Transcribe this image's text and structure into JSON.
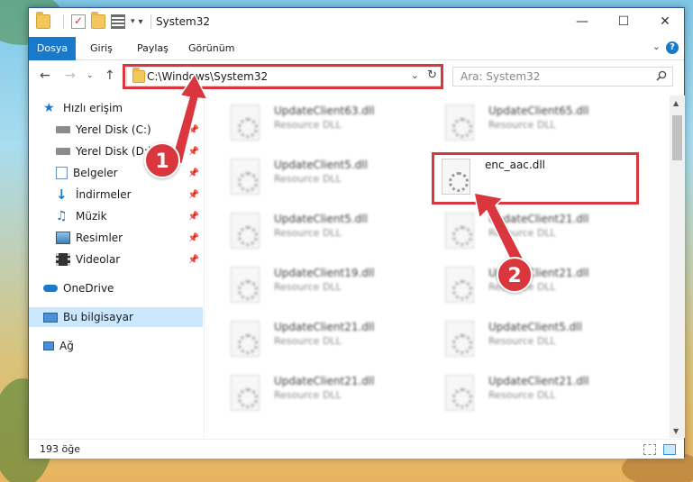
{
  "window": {
    "title": "System32"
  },
  "ribbon": {
    "tabs": [
      "Dosya",
      "Giriş",
      "Paylaş",
      "Görünüm"
    ]
  },
  "address": {
    "path": "C:\\Windows\\System32"
  },
  "search": {
    "placeholder": "Ara: System32"
  },
  "sidebar": {
    "items": [
      {
        "label": "Hızlı erişim",
        "icon": "star-icon"
      },
      {
        "label": "Yerel Disk (C:)",
        "icon": "drive-icon",
        "pinned": true
      },
      {
        "label": "Yerel Disk (D:)",
        "icon": "drive-icon",
        "pinned": true
      },
      {
        "label": "Belgeler",
        "icon": "documents-icon",
        "pinned": true
      },
      {
        "label": "İndirmeler",
        "icon": "download-icon",
        "pinned": true
      },
      {
        "label": "Müzik",
        "icon": "music-icon",
        "pinned": true
      },
      {
        "label": "Resimler",
        "icon": "pictures-icon",
        "pinned": true
      },
      {
        "label": "Videolar",
        "icon": "videos-icon",
        "pinned": true
      },
      {
        "label": "OneDrive",
        "icon": "cloud-icon"
      },
      {
        "label": "Bu bilgisayar",
        "icon": "computer-icon",
        "selected": true
      },
      {
        "label": "Ağ",
        "icon": "network-icon"
      }
    ]
  },
  "files": [
    {
      "name": "UpdateClient63.dll",
      "type": "Resource DLL"
    },
    {
      "name": "UpdateClient65.dll",
      "type": "Resource DLL"
    },
    {
      "name": "UpdateClient5.dll",
      "type": "Resource DLL"
    },
    {
      "name": "enc_aac.dll",
      "type": ""
    },
    {
      "name": "UpdateClient5.dll",
      "type": "Resource DLL"
    },
    {
      "name": "UpdateClient21.dll",
      "type": "Resource DLL"
    },
    {
      "name": "UpdateClient19.dll",
      "type": "Resource DLL"
    },
    {
      "name": "UpdateClient21.dll",
      "type": "Resource DLL"
    },
    {
      "name": "UpdateClient21.dll",
      "type": "Resource DLL"
    },
    {
      "name": "UpdateClient5.dll",
      "type": "Resource DLL"
    },
    {
      "name": "UpdateClient21.dll",
      "type": "Resource DLL"
    },
    {
      "name": "UpdateClient21.dll",
      "type": "Resource DLL"
    }
  ],
  "status": {
    "count": "193 öğe"
  },
  "callouts": {
    "one": "1",
    "two": "2"
  },
  "colors": {
    "accent": "#1979ca",
    "highlight": "#d9363e",
    "selected": "#cce8ff"
  }
}
